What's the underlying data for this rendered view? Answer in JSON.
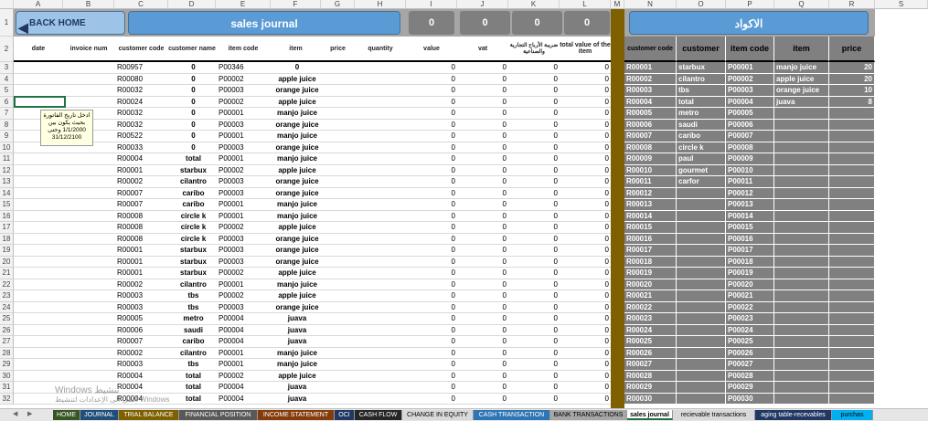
{
  "window": {
    "title": "sales journal"
  },
  "columns": [
    "A",
    "B",
    "C",
    "D",
    "E",
    "F",
    "G",
    "H",
    "I",
    "J",
    "K",
    "L",
    "M",
    "N",
    "O",
    "P",
    "Q",
    "R",
    "S"
  ],
  "rows": [
    "1",
    "2",
    "3",
    "4",
    "5",
    "6",
    "7",
    "8",
    "9",
    "10",
    "11",
    "12",
    "13",
    "14",
    "15",
    "16",
    "17",
    "18",
    "19",
    "20",
    "21",
    "22",
    "23",
    "24",
    "25",
    "26",
    "27",
    "28",
    "29",
    "30",
    "31",
    "32"
  ],
  "header": {
    "back_home": "BACK HOME",
    "journal_title": "sales journal",
    "totals": [
      "0",
      "0",
      "0",
      "0"
    ],
    "codes_title": "الاكواد"
  },
  "table_headers": {
    "date": "date",
    "invoice_num": "invoice num",
    "customer_code": "customer code",
    "customer_name": "customer name",
    "item_code": "item code",
    "item": "item",
    "price": "price",
    "quantity": "quantity",
    "value": "value",
    "vat": "vat",
    "tax": "ضريبة الأرباح التجارية والصناعية",
    "total_value": "total value of the item"
  },
  "rows_data": [
    {
      "cc": "R00957",
      "cn": "0",
      "ic": "P00346",
      "item": "0"
    },
    {
      "cc": "R00080",
      "cn": "0",
      "ic": "P00002",
      "item": "apple juice"
    },
    {
      "cc": "R00032",
      "cn": "0",
      "ic": "P00003",
      "item": "orange juice"
    },
    {
      "cc": "R00024",
      "cn": "0",
      "ic": "P00002",
      "item": "apple juice"
    },
    {
      "cc": "R00032",
      "cn": "0",
      "ic": "P00001",
      "item": "manjo juice"
    },
    {
      "cc": "R00032",
      "cn": "0",
      "ic": "P00003",
      "item": "orange juice"
    },
    {
      "cc": "R00522",
      "cn": "0",
      "ic": "P00001",
      "item": "manjo juice"
    },
    {
      "cc": "R00033",
      "cn": "0",
      "ic": "P00003",
      "item": "orange juice"
    },
    {
      "cc": "R00004",
      "cn": "total",
      "ic": "P00001",
      "item": "manjo juice"
    },
    {
      "cc": "R00001",
      "cn": "starbux",
      "ic": "P00002",
      "item": "apple juice"
    },
    {
      "cc": "R00002",
      "cn": "cilantro",
      "ic": "P00003",
      "item": "orange juice"
    },
    {
      "cc": "R00007",
      "cn": "caribo",
      "ic": "P00003",
      "item": "orange juice"
    },
    {
      "cc": "R00007",
      "cn": "caribo",
      "ic": "P00001",
      "item": "manjo juice"
    },
    {
      "cc": "R00008",
      "cn": "circle k",
      "ic": "P00001",
      "item": "manjo juice"
    },
    {
      "cc": "R00008",
      "cn": "circle k",
      "ic": "P00002",
      "item": "apple juice"
    },
    {
      "cc": "R00008",
      "cn": "circle k",
      "ic": "P00003",
      "item": "orange juice"
    },
    {
      "cc": "R00001",
      "cn": "starbux",
      "ic": "P00003",
      "item": "orange juice"
    },
    {
      "cc": "R00001",
      "cn": "starbux",
      "ic": "P00003",
      "item": "orange juice"
    },
    {
      "cc": "R00001",
      "cn": "starbux",
      "ic": "P00002",
      "item": "apple juice"
    },
    {
      "cc": "R00002",
      "cn": "cilantro",
      "ic": "P00001",
      "item": "manjo juice"
    },
    {
      "cc": "R00003",
      "cn": "tbs",
      "ic": "P00002",
      "item": "apple juice"
    },
    {
      "cc": "R00003",
      "cn": "tbs",
      "ic": "P00003",
      "item": "orange juice"
    },
    {
      "cc": "R00005",
      "cn": "metro",
      "ic": "P00004",
      "item": "juava"
    },
    {
      "cc": "R00006",
      "cn": "saudi",
      "ic": "P00004",
      "item": "juava"
    },
    {
      "cc": "R00007",
      "cn": "caribo",
      "ic": "P00004",
      "item": "juava"
    },
    {
      "cc": "R00002",
      "cn": "cilantro",
      "ic": "P00001",
      "item": "manjo juice"
    },
    {
      "cc": "R00003",
      "cn": "tbs",
      "ic": "P00001",
      "item": "manjo juice"
    },
    {
      "cc": "R00004",
      "cn": "total",
      "ic": "P00002",
      "item": "apple juice"
    },
    {
      "cc": "R00004",
      "cn": "total",
      "ic": "P00004",
      "item": "juava"
    },
    {
      "cc": "R00004",
      "cn": "total",
      "ic": "P00004",
      "item": "juava"
    }
  ],
  "zero": "0",
  "comment_text": "ادخل تاريخ الفاتورة بحيث يكون بين 1/1/2000 وحتى 31/12/2100",
  "codes_headers": {
    "customer_code": "customer code",
    "customer": "customer",
    "item_code": "item code",
    "item": "item",
    "price": "price"
  },
  "codes_rows": [
    {
      "cc": "R00001",
      "cn": "starbux",
      "ic": "P00001",
      "it": "manjo juice",
      "pr": "20"
    },
    {
      "cc": "R00002",
      "cn": "cilantro",
      "ic": "P00002",
      "it": "apple juice",
      "pr": "20"
    },
    {
      "cc": "R00003",
      "cn": "tbs",
      "ic": "P00003",
      "it": "orange juice",
      "pr": "10"
    },
    {
      "cc": "R00004",
      "cn": "total",
      "ic": "P00004",
      "it": "juava",
      "pr": "8"
    },
    {
      "cc": "R00005",
      "cn": "metro",
      "ic": "P00005",
      "it": "",
      "pr": ""
    },
    {
      "cc": "R00006",
      "cn": "saudi",
      "ic": "P00006",
      "it": "",
      "pr": ""
    },
    {
      "cc": "R00007",
      "cn": "caribo",
      "ic": "P00007",
      "it": "",
      "pr": ""
    },
    {
      "cc": "R00008",
      "cn": "circle k",
      "ic": "P00008",
      "it": "",
      "pr": ""
    },
    {
      "cc": "R00009",
      "cn": "paul",
      "ic": "P00009",
      "it": "",
      "pr": ""
    },
    {
      "cc": "R00010",
      "cn": "gourmet",
      "ic": "P00010",
      "it": "",
      "pr": ""
    },
    {
      "cc": "R00011",
      "cn": "carfor",
      "ic": "P00011",
      "it": "",
      "pr": ""
    },
    {
      "cc": "R00012",
      "cn": "",
      "ic": "P00012",
      "it": "",
      "pr": ""
    },
    {
      "cc": "R00013",
      "cn": "",
      "ic": "P00013",
      "it": "",
      "pr": ""
    },
    {
      "cc": "R00014",
      "cn": "",
      "ic": "P00014",
      "it": "",
      "pr": ""
    },
    {
      "cc": "R00015",
      "cn": "",
      "ic": "P00015",
      "it": "",
      "pr": ""
    },
    {
      "cc": "R00016",
      "cn": "",
      "ic": "P00016",
      "it": "",
      "pr": ""
    },
    {
      "cc": "R00017",
      "cn": "",
      "ic": "P00017",
      "it": "",
      "pr": ""
    },
    {
      "cc": "R00018",
      "cn": "",
      "ic": "P00018",
      "it": "",
      "pr": ""
    },
    {
      "cc": "R00019",
      "cn": "",
      "ic": "P00019",
      "it": "",
      "pr": ""
    },
    {
      "cc": "R00020",
      "cn": "",
      "ic": "P00020",
      "it": "",
      "pr": ""
    },
    {
      "cc": "R00021",
      "cn": "",
      "ic": "P00021",
      "it": "",
      "pr": ""
    },
    {
      "cc": "R00022",
      "cn": "",
      "ic": "P00022",
      "it": "",
      "pr": ""
    },
    {
      "cc": "R00023",
      "cn": "",
      "ic": "P00023",
      "it": "",
      "pr": ""
    },
    {
      "cc": "R00024",
      "cn": "",
      "ic": "P00024",
      "it": "",
      "pr": ""
    },
    {
      "cc": "R00025",
      "cn": "",
      "ic": "P00025",
      "it": "",
      "pr": ""
    },
    {
      "cc": "R00026",
      "cn": "",
      "ic": "P00026",
      "it": "",
      "pr": ""
    },
    {
      "cc": "R00027",
      "cn": "",
      "ic": "P00027",
      "it": "",
      "pr": ""
    },
    {
      "cc": "R00028",
      "cn": "",
      "ic": "P00028",
      "it": "",
      "pr": ""
    },
    {
      "cc": "R00029",
      "cn": "",
      "ic": "P00029",
      "it": "",
      "pr": ""
    },
    {
      "cc": "R00030",
      "cn": "",
      "ic": "P00030",
      "it": "",
      "pr": ""
    }
  ],
  "watermark": {
    "line1": "Windows تنشيط",
    "line2": "انتقل الى الإعدادات لتنشيط Windows"
  },
  "tabs": [
    {
      "label": "HOME",
      "color": "#375623"
    },
    {
      "label": "JOURNAL",
      "color": "#1f4e79"
    },
    {
      "label": "TRIAL BALANCE",
      "color": "#7f6000"
    },
    {
      "label": "FINANCIAL POSITION",
      "color": "#595959"
    },
    {
      "label": "INCOME STATEMENT",
      "color": "#843c0c"
    },
    {
      "label": "OCI",
      "color": "#1f3864"
    },
    {
      "label": "CASH FLOW",
      "color": "#262626"
    },
    {
      "label": "CHANGE IN EQUITY",
      "color": "#d9d9d9"
    },
    {
      "label": "CASH TRANSACTION",
      "color": "#2e75b6"
    },
    {
      "label": "BANK TRANSACTIONS",
      "color": "#a6a6a6"
    },
    {
      "label": "sales journal",
      "color": "#ffffff"
    },
    {
      "label": "recievable transactions",
      "color": "#d9d9d9"
    },
    {
      "label": "aging table-recevables",
      "color": "#1f3864"
    },
    {
      "label": "purchas",
      "color": "#00b0f0"
    }
  ]
}
